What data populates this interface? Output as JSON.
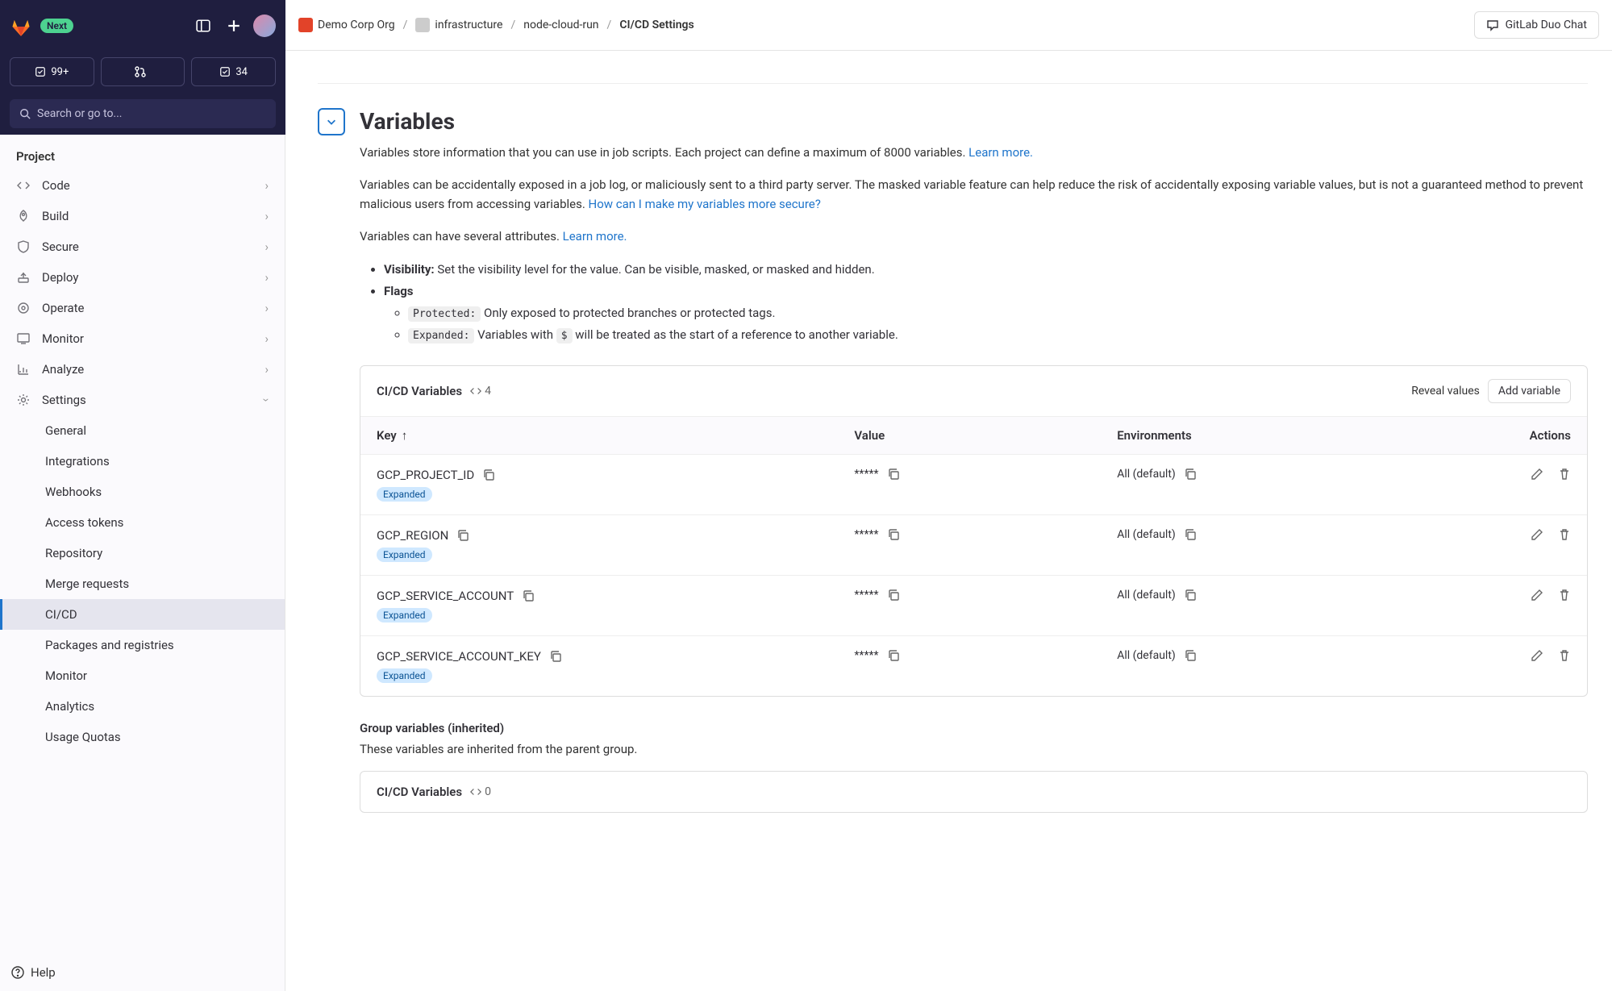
{
  "topbar": {
    "next_badge": "Next",
    "todos_count": "99+",
    "mr_count": "",
    "issues_count": "34",
    "search_placeholder": "Search or go to..."
  },
  "breadcrumb": {
    "org": "Demo Corp Org",
    "group": "infrastructure",
    "project": "node-cloud-run",
    "page": "CI/CD Settings",
    "duo_btn": "GitLab Duo Chat"
  },
  "sidebar": {
    "section": "Project",
    "items": [
      {
        "label": "Code"
      },
      {
        "label": "Build"
      },
      {
        "label": "Secure"
      },
      {
        "label": "Deploy"
      },
      {
        "label": "Operate"
      },
      {
        "label": "Monitor"
      },
      {
        "label": "Analyze"
      }
    ],
    "settings_label": "Settings",
    "settings_sub": [
      "General",
      "Integrations",
      "Webhooks",
      "Access tokens",
      "Repository",
      "Merge requests",
      "CI/CD",
      "Packages and registries",
      "Monitor",
      "Analytics",
      "Usage Quotas"
    ],
    "help": "Help"
  },
  "variables": {
    "title": "Variables",
    "intro": "Variables store information that you can use in job scripts. Each project can define a maximum of 8000 variables. ",
    "learn_more": "Learn more.",
    "masked_para_1": "Variables can be accidentally exposed in a job log, or maliciously sent to a third party server. The masked variable feature can help reduce the risk of accidentally exposing variable values, but is not a guaranteed method to prevent malicious users from accessing variables. ",
    "masked_link": "How can I make my variables more secure?",
    "attrs_para": "Variables can have several attributes. ",
    "visibility_label": "Visibility:",
    "visibility_text": " Set the visibility level for the value. Can be visible, masked, or masked and hidden.",
    "flags_label": "Flags",
    "protected_tag": "Protected:",
    "protected_text": " Only exposed to protected branches or protected tags.",
    "expanded_tag": "Expanded:",
    "expanded_text_1": " Variables with ",
    "expanded_dollar": "$",
    "expanded_text_2": " will be treated as the start of a reference to another variable."
  },
  "card": {
    "title": "CI/CD Variables",
    "count": "4",
    "reveal": "Reveal values",
    "add": "Add variable",
    "col_key": "Key",
    "col_value": "Value",
    "col_env": "Environments",
    "col_actions": "Actions",
    "rows": [
      {
        "key": "GCP_PROJECT_ID",
        "value": "*****",
        "env": "All (default)",
        "badge": "Expanded"
      },
      {
        "key": "GCP_REGION",
        "value": "*****",
        "env": "All (default)",
        "badge": "Expanded"
      },
      {
        "key": "GCP_SERVICE_ACCOUNT",
        "value": "*****",
        "env": "All (default)",
        "badge": "Expanded"
      },
      {
        "key": "GCP_SERVICE_ACCOUNT_KEY",
        "value": "*****",
        "env": "All (default)",
        "badge": "Expanded"
      }
    ]
  },
  "group": {
    "title": "Group variables (inherited)",
    "desc": "These variables are inherited from the parent group.",
    "card_title": "CI/CD Variables",
    "card_count": "0"
  }
}
